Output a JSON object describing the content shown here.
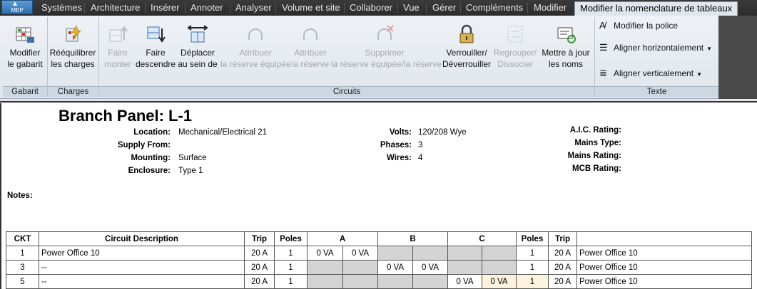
{
  "tabs": {
    "app_button": "MEP",
    "items": [
      "Systèmes",
      "Architecture",
      "Insérer",
      "Annoter",
      "Analyser",
      "Volume et site",
      "Collaborer",
      "Vue",
      "Gérer",
      "Compléments",
      "Modifier"
    ],
    "active": "Modifier la nomenclature de tableaux"
  },
  "ribbon": {
    "gabarit": {
      "modifier_l1": "Modifier",
      "modifier_l2": "le gabarit",
      "panel": "Gabarit"
    },
    "charges": {
      "reequilibrer_l1": "Rééquilibrer",
      "reequilibrer_l2": "les charges",
      "panel": "Charges"
    },
    "circuits": {
      "panel": "Circuits",
      "faire_monter_l1": "Faire",
      "faire_monter_l2": "monter",
      "faire_descendre_l1": "Faire",
      "faire_descendre_l2": "descendre",
      "deplacer_l1": "Déplacer",
      "deplacer_l2": "au sein de",
      "attribuer_eq_l1": "Attribuer",
      "attribuer_eq_l2": "la réserve équipée",
      "attribuer_res_l1": "Attribuer",
      "attribuer_res_l2": "la réserve",
      "supprimer_l1": "Supprimer",
      "supprimer_l2": "la réserve équipée/la réserve",
      "verrouiller_l1": "Verrouiller/",
      "verrouiller_l2": "Déverrouiller",
      "regrouper_l1": "Regrouper/",
      "regrouper_l2": "Dissocier",
      "mettre_l1": "Mettre à jour",
      "mettre_l2": "les noms"
    },
    "texte": {
      "panel": "Texte",
      "police": "Modifier la police",
      "horiz": "Aligner horizontalement",
      "vert": "Aligner verticalement"
    }
  },
  "schedule": {
    "panel_name": "Branch Panel: L-1",
    "fields": {
      "location_label": "Location:",
      "location_value": "Mechanical/Electrical 21",
      "supply_label": "Supply From:",
      "supply_value": "",
      "mounting_label": "Mounting:",
      "mounting_value": "Surface",
      "enclosure_label": "Enclosure:",
      "enclosure_value": "Type 1",
      "volts_label": "Volts:",
      "volts_value": "120/208 Wye",
      "phases_label": "Phases:",
      "phases_value": "3",
      "wires_label": "Wires:",
      "wires_value": "4",
      "aic_label": "A.I.C. Rating:",
      "mains_type_label": "Mains Type:",
      "mains_rating_label": "Mains Rating:",
      "mcb_label": "MCB Rating:"
    },
    "notes_label": "Notes:",
    "headers": {
      "ckt": "CKT",
      "desc": "Circuit Description",
      "trip": "Trip",
      "poles": "Poles",
      "a": "A",
      "b": "B",
      "c": "C",
      "poles_r": "Poles",
      "trip_r": "Trip",
      "desc_r": ""
    },
    "rows": [
      {
        "ckt": "1",
        "desc": "Power Office 10",
        "trip": "20 A",
        "poles": "1",
        "a1": "0 VA",
        "a2": "0 VA",
        "b1": "",
        "b2": "",
        "c1": "",
        "c2": "",
        "poles_r": "1",
        "trip_r": "20 A",
        "desc_r": "Power Office 10"
      },
      {
        "ckt": "3",
        "desc": "--",
        "trip": "20 A",
        "poles": "1",
        "a1": "",
        "a2": "",
        "b1": "0 VA",
        "b2": "0 VA",
        "c1": "",
        "c2": "",
        "poles_r": "1",
        "trip_r": "20 A",
        "desc_r": "Power Office 10"
      },
      {
        "ckt": "5",
        "desc": "--",
        "trip": "20 A",
        "poles": "1",
        "a1": "",
        "a2": "",
        "b1": "",
        "b2": "",
        "c1": "0 VA",
        "c2": "0 VA",
        "poles_r": "1",
        "trip_r": "20 A",
        "desc_r": "Power Office 10"
      }
    ]
  }
}
